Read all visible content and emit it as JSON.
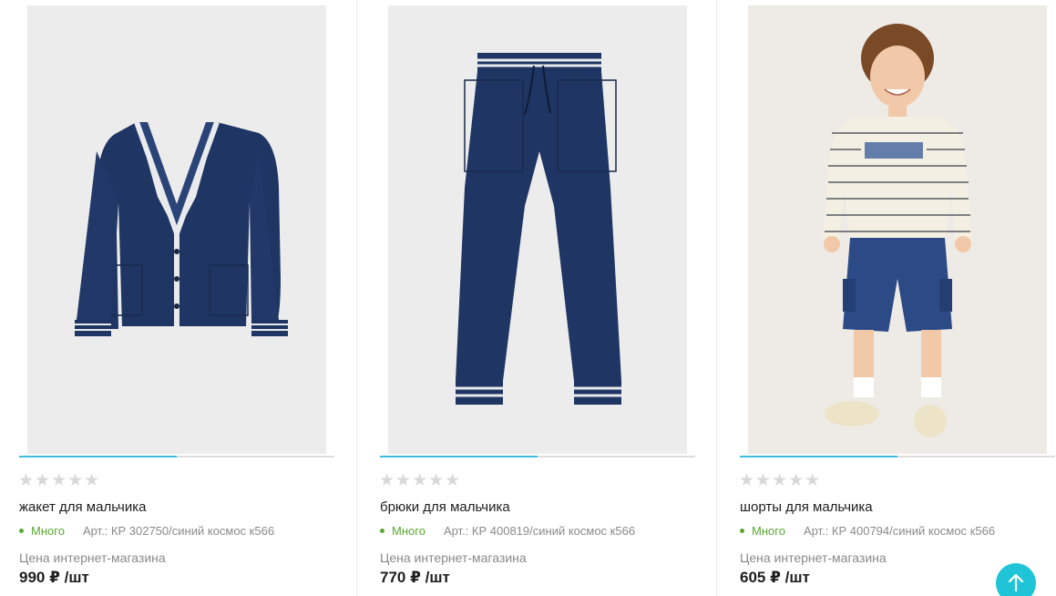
{
  "products": [
    {
      "title": "жакет для мальчика",
      "stars": "★★★★★",
      "stock": "Много",
      "article": "Арт.: КР 302750/синий космос к566",
      "price_label": "Цена интернет-магазина",
      "price": "990 ₽ /шт",
      "image_icon": "cardigan-image",
      "gallery_progress": 0.5
    },
    {
      "title": "брюки для мальчика",
      "stars": "★★★★★",
      "stock": "Много",
      "article": "Арт.: КР 400819/синий космос к566",
      "price_label": "Цена интернет-магазина",
      "price": "770 ₽ /шт",
      "image_icon": "trousers-image",
      "gallery_progress": 0.5
    },
    {
      "title": "шорты для мальчика",
      "stars": "★★★★★",
      "stock": "Много",
      "article": "Арт.: КР 400794/синий космос к566",
      "price_label": "Цена интернет-магазина",
      "price": "605 ₽ /шт",
      "image_icon": "boy-in-shorts-image",
      "gallery_progress": 0.5
    }
  ],
  "scroll_top": {
    "icon": "arrow-up-icon"
  },
  "colors": {
    "accent": "#3cbde0",
    "stock_green": "#5aa832",
    "navy": "#1f3563",
    "scroll_button": "#1fc5d6"
  }
}
